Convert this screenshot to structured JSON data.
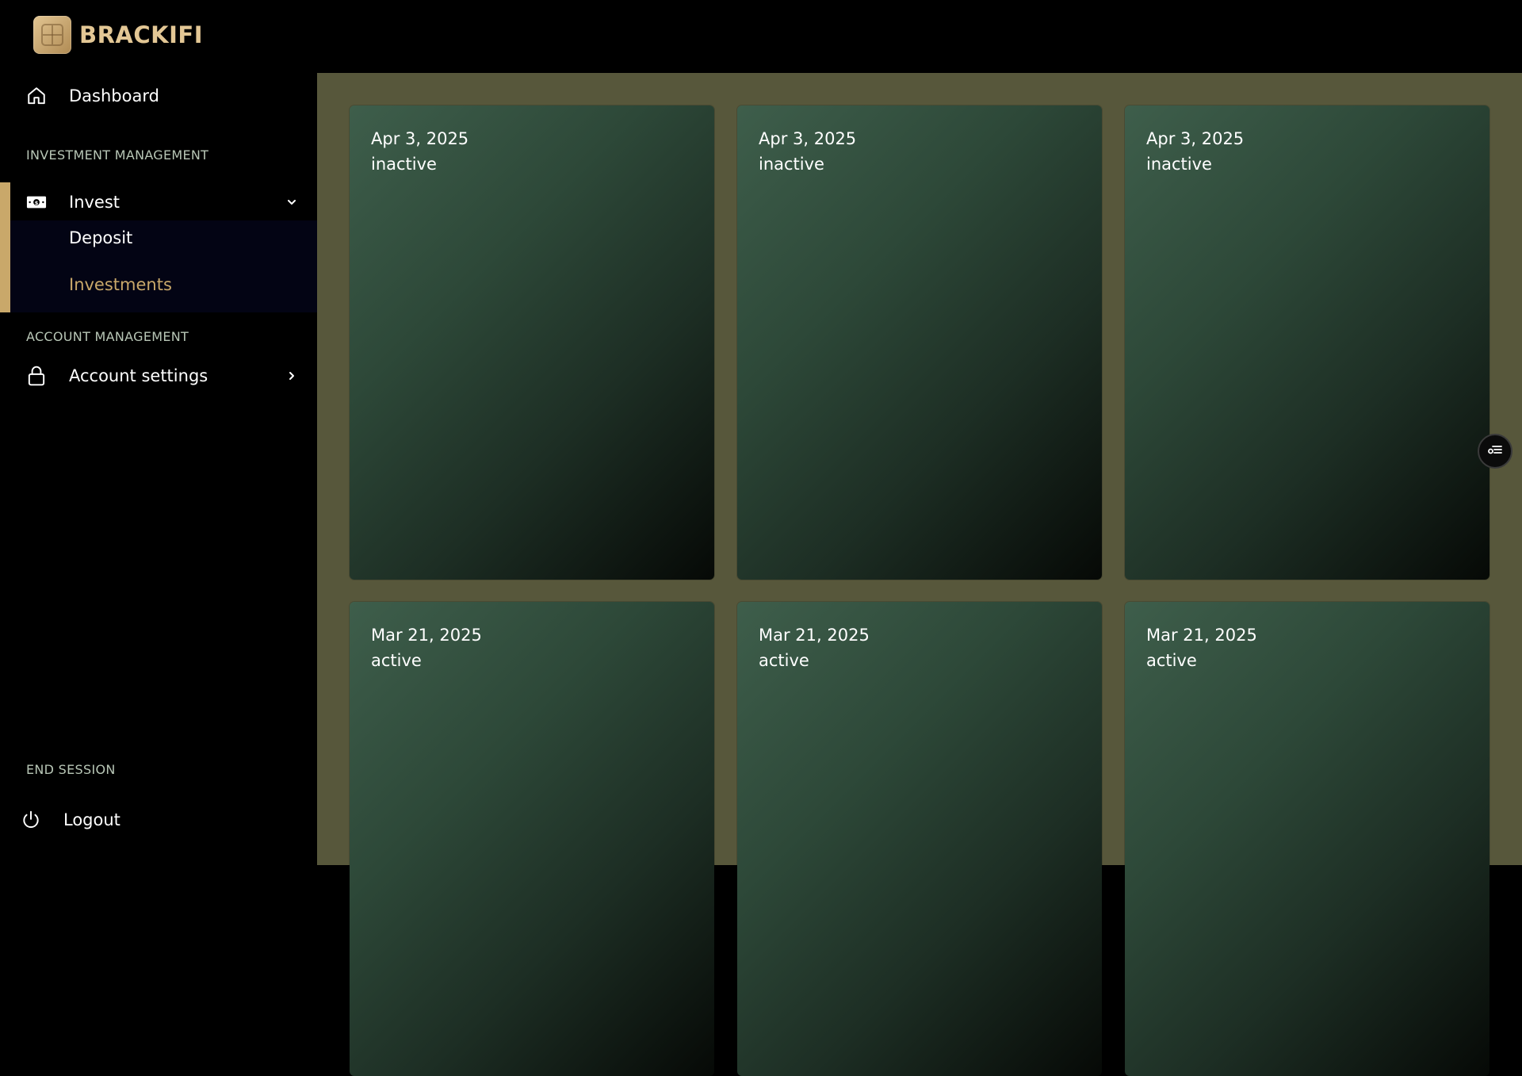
{
  "brand": {
    "name": "BRACKIFI"
  },
  "sidebar": {
    "dashboard_label": "Dashboard",
    "investment_section": "INVESTMENT MANAGEMENT",
    "invest_label": "Invest",
    "invest_submenu": [
      {
        "label": "Deposit"
      },
      {
        "label": "Investments"
      }
    ],
    "account_section": "ACCOUNT MANAGEMENT",
    "account_settings_label": "Account settings",
    "end_session_section": "END SESSION",
    "logout_label": "Logout"
  },
  "cards": [
    {
      "date": "Apr 3, 2025",
      "status": "inactive"
    },
    {
      "date": "Apr 3, 2025",
      "status": "inactive"
    },
    {
      "date": "Apr 3, 2025",
      "status": "inactive"
    },
    {
      "date": "Mar 21, 2025",
      "status": "active"
    },
    {
      "date": "Mar 21, 2025",
      "status": "active"
    },
    {
      "date": "Mar 21, 2025",
      "status": "active"
    }
  ],
  "colors": {
    "accent_gold": "#c9a86a",
    "content_bg": "#57573b",
    "card_green": "#3e5e4b",
    "active_submenu_text": "#c9a86a"
  },
  "icons": {
    "dashboard": "home-icon",
    "invest": "banknote-icon",
    "account_settings": "lock-icon",
    "logout": "power-icon",
    "floating": "filter-list-icon"
  }
}
